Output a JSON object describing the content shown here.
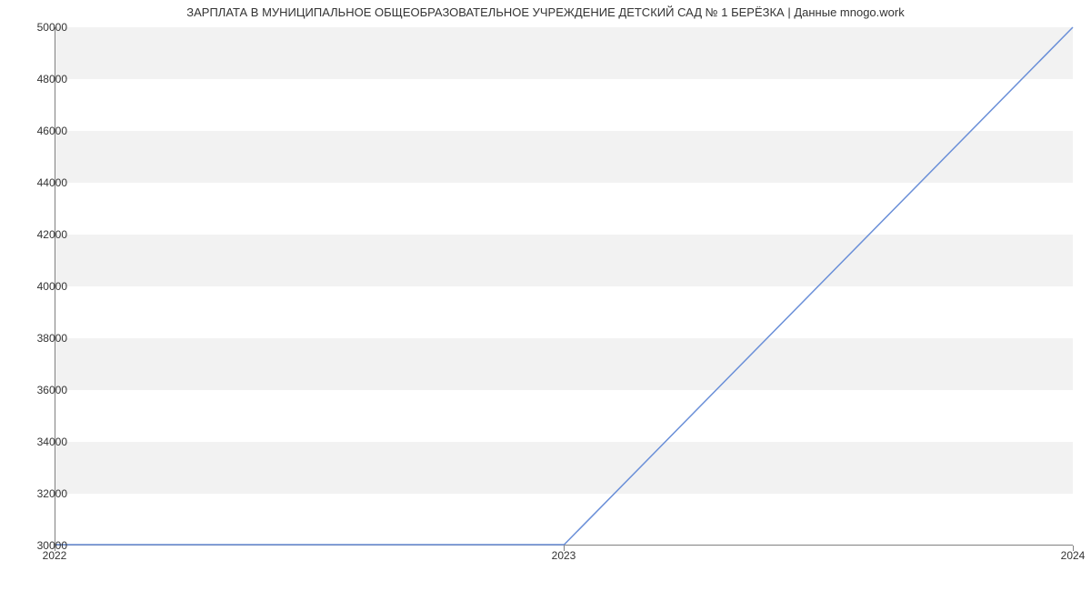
{
  "chart_data": {
    "type": "line",
    "title": "ЗАРПЛАТА В МУНИЦИПАЛЬНОЕ ОБЩЕОБРАЗОВАТЕЛЬНОЕ УЧРЕЖДЕНИЕ ДЕТСКИЙ САД № 1 БЕРЁЗКА | Данные mnogo.work",
    "xlabel": "",
    "ylabel": "",
    "x_ticks": [
      "2022",
      "2023",
      "2024"
    ],
    "y_ticks": [
      30000,
      32000,
      34000,
      36000,
      38000,
      40000,
      42000,
      44000,
      46000,
      48000,
      50000
    ],
    "ylim": [
      30000,
      50000
    ],
    "xlim": [
      2022,
      2024
    ],
    "series": [
      {
        "name": "salary",
        "x": [
          2022,
          2023,
          2024
        ],
        "values": [
          30000,
          30000,
          50000
        ]
      }
    ],
    "line_color": "#6a8fd8"
  }
}
